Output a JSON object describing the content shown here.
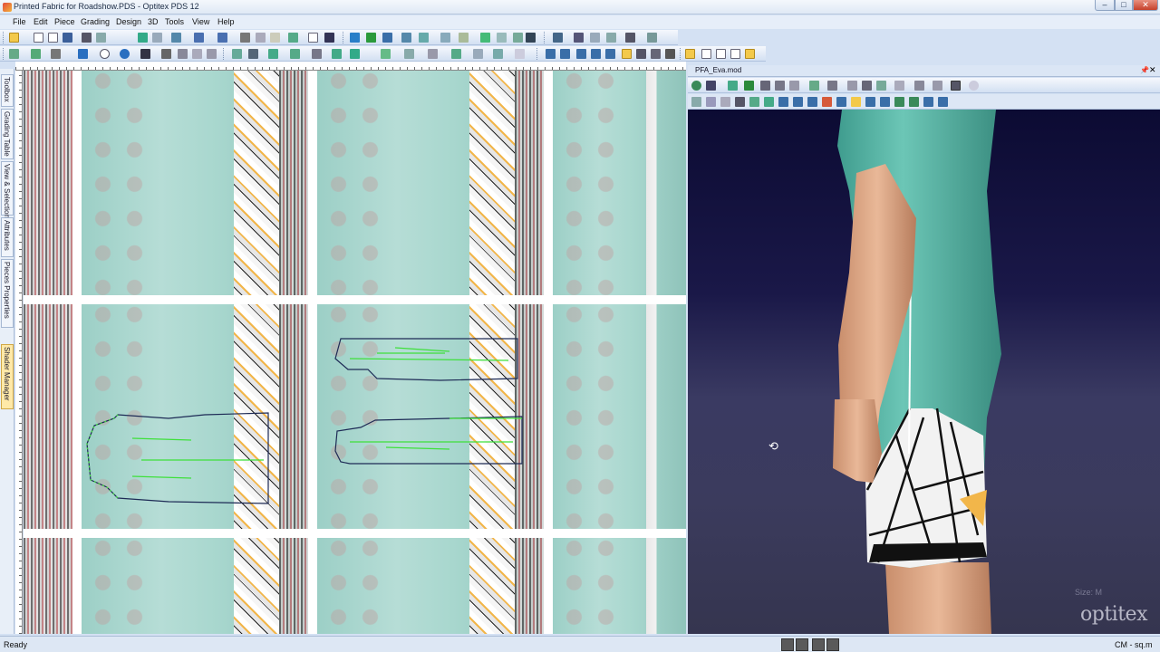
{
  "window": {
    "title": "Printed Fabric for Roadshow.PDS - Optitex PDS 12",
    "controls": {
      "minimize": "–",
      "maximize": "□",
      "close": "✕"
    }
  },
  "menu": {
    "items": [
      "File",
      "Edit",
      "Piece",
      "Grading",
      "Design",
      "3D",
      "Tools",
      "View",
      "Help"
    ]
  },
  "side_tabs": [
    "Toolbox",
    "Grading Table",
    "View & Selection",
    "Attributes",
    "Pieces Properties",
    "Shader Manager"
  ],
  "view3d": {
    "title": "PFA_Eva.mod",
    "size_label": "Size: M",
    "brand": "optitex"
  },
  "status": {
    "left": "Ready",
    "units": "CM - sq.m"
  },
  "colors": {
    "accent": "#d4e1f3",
    "fabric_teal": "#a8d7ce",
    "piece_outline": "#1d2a55",
    "piece_internal": "#3ee03a",
    "background_3d": "#1a1848"
  },
  "icons": {
    "rotate": "rotate-cursor-icon",
    "pin": "pin-icon",
    "close": "close-icon"
  }
}
